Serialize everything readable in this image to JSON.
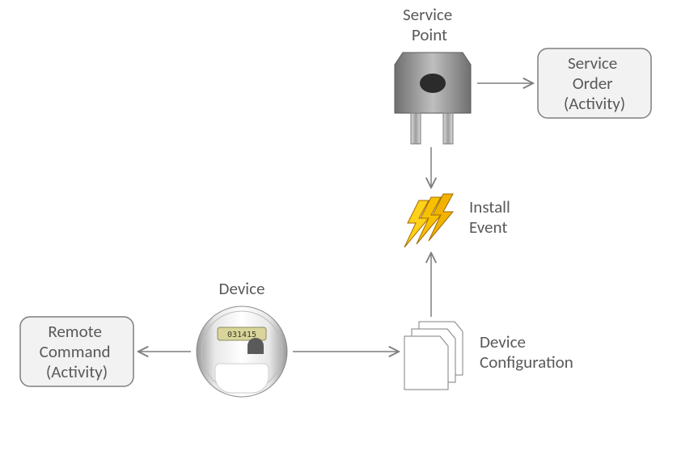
{
  "nodes": {
    "service_point": {
      "label1": "Service",
      "label2": "Point"
    },
    "service_order": {
      "label1": "Service",
      "label2": "Order",
      "label3": "(Activity)"
    },
    "install_event": {
      "label1": "Install",
      "label2": "Event"
    },
    "device": {
      "label": "Device",
      "reading": "031415"
    },
    "device_config": {
      "label1": "Device",
      "label2": "Configuration"
    },
    "remote_command": {
      "label1": "Remote",
      "label2": "Command",
      "label3": "(Activity)"
    }
  }
}
